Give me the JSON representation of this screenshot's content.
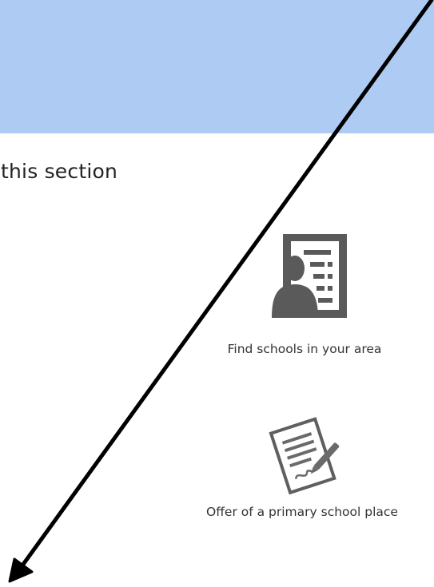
{
  "section": {
    "heading": "this section"
  },
  "tiles": [
    {
      "label": "Find schools in your area",
      "icon": "teacher-board-icon"
    },
    {
      "label": "Offer of a primary school place",
      "icon": "sign-document-icon"
    }
  ],
  "colors": {
    "banner": "#aecbf4",
    "icon_gray": "#595959",
    "arrow": "#000000"
  }
}
